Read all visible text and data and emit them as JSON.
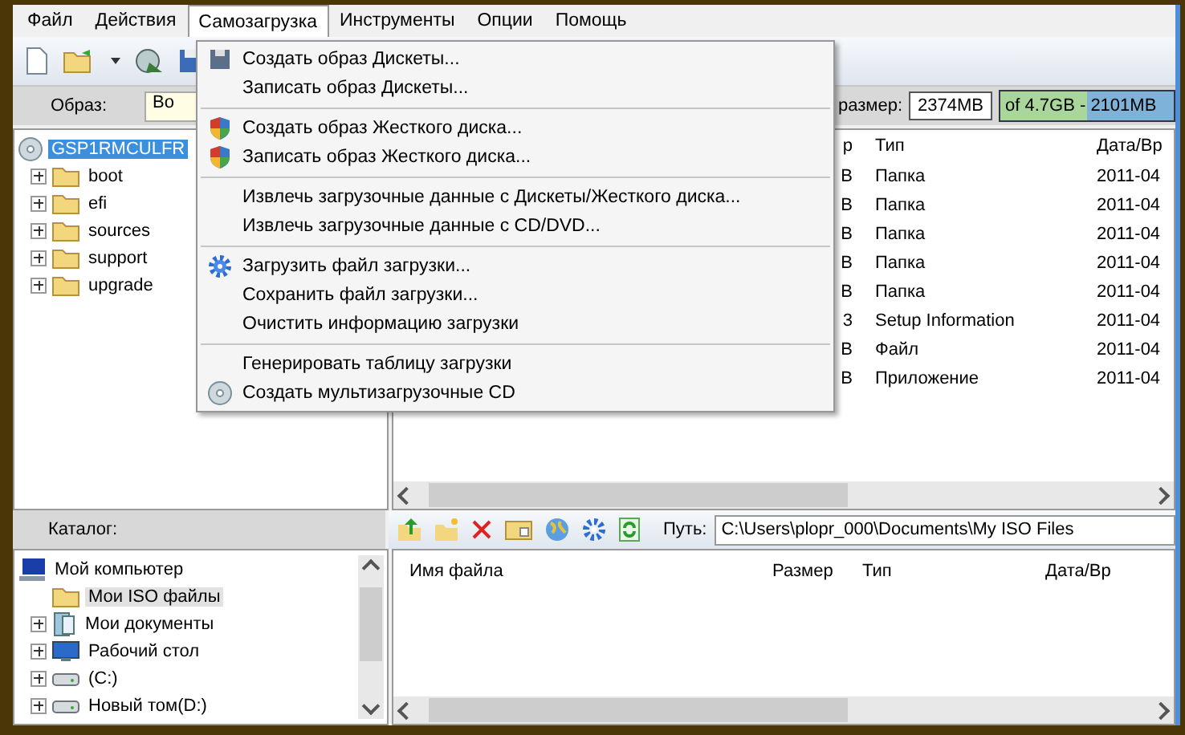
{
  "menu_bar": [
    {
      "label": "Файл",
      "selected": false
    },
    {
      "label": "Действия",
      "selected": false
    },
    {
      "label": "Самозагрузка",
      "selected": true
    },
    {
      "label": "Инструменты",
      "selected": false
    },
    {
      "label": "Опции",
      "selected": false
    },
    {
      "label": "Помощь",
      "selected": false
    }
  ],
  "image_bar": {
    "label": "Образ:",
    "value": "Во",
    "size_label": "размер:",
    "size_value": "2374MB",
    "capacity": {
      "text": "of 4.7GB - 2101MB",
      "level": 0.5
    }
  },
  "image_tree": {
    "label": "GSP1RMCULFR",
    "selected": true,
    "kind": "disc",
    "children": [
      {
        "label": "boot",
        "kind": "folder"
      },
      {
        "label": "efi",
        "kind": "folder"
      },
      {
        "label": "sources",
        "kind": "folder"
      },
      {
        "label": "support",
        "kind": "folder"
      },
      {
        "label": "upgrade",
        "kind": "folder"
      }
    ]
  },
  "image_table": {
    "columns": [
      "р",
      "Тип",
      "Дата/Вр"
    ],
    "rows": [
      {
        "column_1": "B",
        "type": "Папка",
        "date": "2011-04"
      },
      {
        "column_1": "B",
        "type": "Папка",
        "date": "2011-04"
      },
      {
        "column_1": "B",
        "type": "Папка",
        "date": "2011-04"
      },
      {
        "column_1": "B",
        "type": "Папка",
        "date": "2011-04"
      },
      {
        "column_1": "B",
        "type": "Папка",
        "date": "2011-04"
      },
      {
        "column_1": "3",
        "type": "Setup Information",
        "date": "2011-04"
      },
      {
        "column_1": "B",
        "type": "Файл",
        "date": "2011-04"
      },
      {
        "column_1": "B",
        "type": "Приложение",
        "date": "2011-04"
      }
    ]
  },
  "dropdown_menu": [
    {
      "kind": "floppy",
      "label": "Создать образ Дискеты..."
    },
    {
      "kind": "plain",
      "label": "Записать образ Дискеты..."
    },
    {
      "kind": "separator"
    },
    {
      "kind": "shield",
      "label": "Создать образ Жесткого диска..."
    },
    {
      "kind": "shield",
      "label": "Записать образ Жесткого диска..."
    },
    {
      "kind": "separator"
    },
    {
      "kind": "plain",
      "label": "Извлечь загрузочные данные с Дискеты/Жесткого диска..."
    },
    {
      "kind": "plain",
      "label": "Извлечь загрузочные данные с CD/DVD..."
    },
    {
      "kind": "separator"
    },
    {
      "kind": "gear",
      "label": "Загрузить файл загрузки..."
    },
    {
      "kind": "plain",
      "label": "Сохранить файл загрузки..."
    },
    {
      "kind": "plain",
      "label": "Очистить информацию загрузки"
    },
    {
      "kind": "separator"
    },
    {
      "kind": "plain",
      "label": "Генерировать таблицу загрузки"
    },
    {
      "kind": "disc",
      "label": "Создать мультизагрузочные CD"
    }
  ],
  "catalog": {
    "label": "Каталог:",
    "tree": {
      "label": "Мой компьютер",
      "kind": "computer",
      "selected": false,
      "children": [
        {
          "label": "Мои ISO файлы",
          "kind": "folder",
          "selected": true,
          "expandable": false
        },
        {
          "label": "Мои документы",
          "kind": "documents",
          "selected": false,
          "expandable": true
        },
        {
          "label": "Рабочий стол",
          "kind": "desktop",
          "selected": false,
          "expandable": true
        },
        {
          "label": "(C:)",
          "kind": "drive",
          "selected": false,
          "expandable": true
        },
        {
          "label": "Новый том(D:)",
          "kind": "drive",
          "selected": false,
          "expandable": true
        }
      ]
    }
  },
  "local_files": {
    "path_label": "Путь:",
    "path": "C:\\Users\\plopr_000\\Documents\\My ISO Files",
    "columns": [
      "Имя файла",
      "Размер",
      "Тип",
      "Дата/Вр"
    ]
  }
}
